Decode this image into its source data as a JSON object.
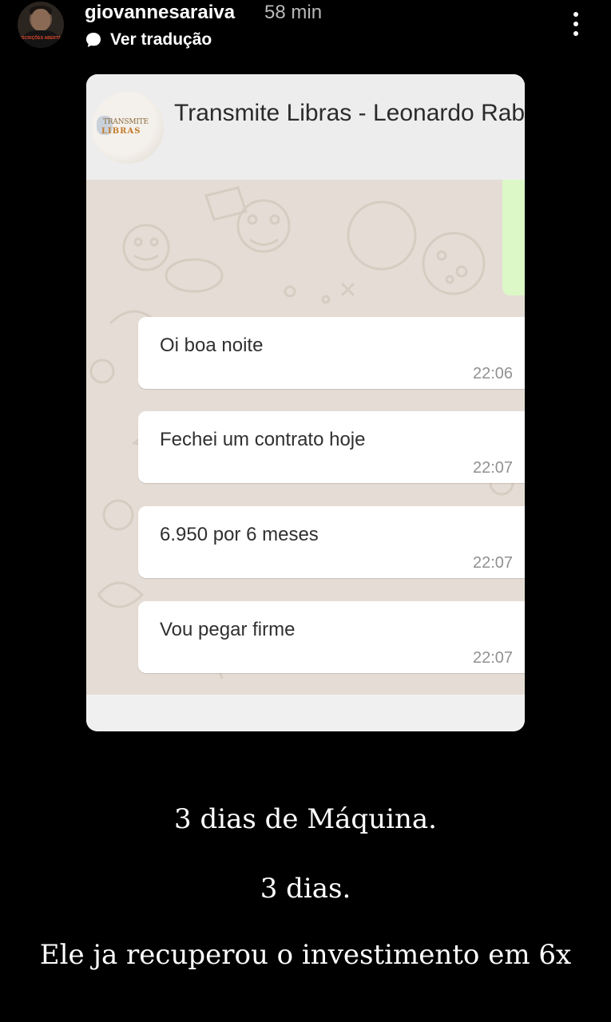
{
  "story_header": {
    "username": "giovannesaraiva",
    "time_ago": "58 min",
    "translate_label": "Ver tradução",
    "avatar_badge": "INSCRIÇÕES ABERTAS"
  },
  "chat": {
    "title": "Transmite Libras - Leonardo Rab",
    "group_avatar_text": [
      "TRANSMITE",
      "LIBRAS"
    ],
    "messages": [
      {
        "text": "Oi boa noite",
        "time": "22:06"
      },
      {
        "text": "Fechei um contrato hoje",
        "time": "22:07"
      },
      {
        "text": "6.950 por 6 meses",
        "time": "22:07"
      },
      {
        "text": "Vou pegar firme",
        "time": "22:07"
      }
    ]
  },
  "captions": {
    "line1": "3 dias de Máquina.",
    "line2": "3 dias.",
    "line3": "Ele ja recuperou o investimento em 6x"
  },
  "colors": {
    "background": "#000000",
    "chat_wallpaper": "#e5ddd5",
    "sent_bubble": "#dcf8c6",
    "received_bubble": "#ffffff"
  },
  "icons": [
    "translate-icon",
    "more-options-icon"
  ]
}
